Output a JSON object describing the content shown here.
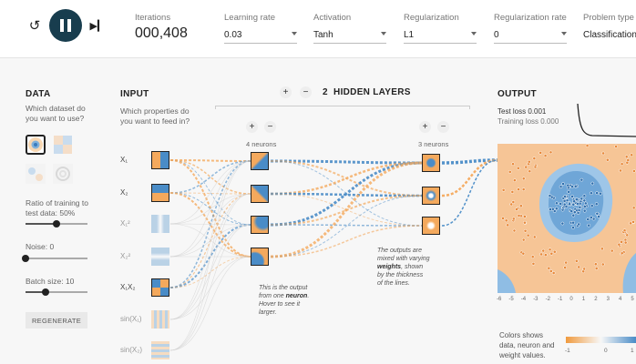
{
  "controls": {
    "iterations_label": "Iterations",
    "iterations_value": "000,408",
    "learning_rate_label": "Learning rate",
    "learning_rate_value": "0.03",
    "activation_label": "Activation",
    "activation_value": "Tanh",
    "regularization_label": "Regularization",
    "regularization_value": "L1",
    "regularization_rate_label": "Regularization rate",
    "regularization_rate_value": "0",
    "problem_type_label": "Problem type",
    "problem_type_value": "Classification"
  },
  "data_panel": {
    "heading": "DATA",
    "question": "Which dataset do you want to use?",
    "ratio_label": "Ratio of training to test data:",
    "ratio_value": "50%",
    "ratio_fraction": 0.5,
    "noise_label": "Noise:",
    "noise_value": "0",
    "noise_fraction": 0.0,
    "batch_label": "Batch size:",
    "batch_value": "10",
    "batch_fraction": 0.33,
    "regenerate_label": "REGENERATE"
  },
  "input_panel": {
    "heading": "INPUT",
    "question": "Which properties do you want to feed in?",
    "features": [
      {
        "label": "X₁",
        "active": true
      },
      {
        "label": "X₂",
        "active": true
      },
      {
        "label": "X₁²",
        "active": false
      },
      {
        "label": "X₂²",
        "active": false
      },
      {
        "label": "X₁X₂",
        "active": true
      },
      {
        "label": "sin(X₁)",
        "active": false
      },
      {
        "label": "sin(X₂)",
        "active": false
      }
    ]
  },
  "hidden": {
    "count": "2",
    "heading": "HIDDEN LAYERS",
    "layer1_label": "4 neurons",
    "layer2_label": "3 neurons",
    "note_neuron": [
      "This is the output",
      "from one ",
      "neuron",
      ".",
      "Hover to see it",
      "larger."
    ],
    "note_weights": [
      "The outputs are",
      "mixed with varying",
      "weights",
      ", shown",
      "by the thickness",
      "of the lines."
    ]
  },
  "output_panel": {
    "heading": "OUTPUT",
    "test_loss": "Test loss 0.001",
    "training_loss": "Training loss 0.000",
    "axis_ticks": [
      "-6",
      "-5",
      "-4",
      "-3",
      "-2",
      "-1",
      "0",
      "1",
      "2",
      "3",
      "4",
      "5",
      "6"
    ],
    "legend_text": [
      "Colors shows",
      "data, neuron and",
      "weight values."
    ],
    "legend_min": "-1",
    "legend_mid": "0",
    "legend_max": "1"
  },
  "colors": {
    "orange": "#f4a95d",
    "blue": "#4a8cc7",
    "dark": "#183d4e"
  }
}
